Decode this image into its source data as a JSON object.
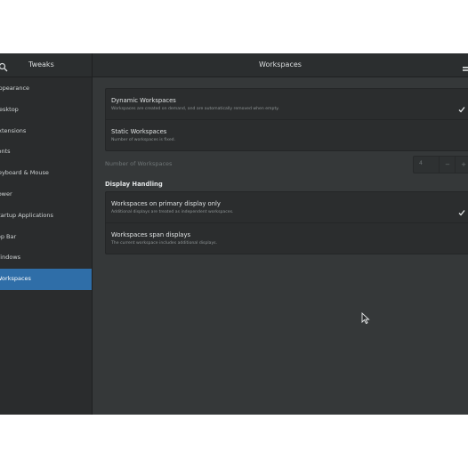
{
  "window": {
    "app_title": "Tweaks",
    "page_title": "Workspaces"
  },
  "sidebar": {
    "items": [
      {
        "label": "Appearance"
      },
      {
        "label": "Desktop"
      },
      {
        "label": "Extensions"
      },
      {
        "label": "Fonts"
      },
      {
        "label": "Keyboard & Mouse"
      },
      {
        "label": "Power"
      },
      {
        "label": "Startup Applications"
      },
      {
        "label": "Top Bar"
      },
      {
        "label": "Windows"
      },
      {
        "label": "Workspaces",
        "active": true
      }
    ]
  },
  "workspaces": {
    "dynamic": {
      "title": "Dynamic Workspaces",
      "subtitle": "Workspaces are created on demand, and are automatically removed when empty.",
      "checked": true
    },
    "static": {
      "title": "Static Workspaces",
      "subtitle": "Number of workspaces is fixed.",
      "checked": false
    },
    "number_label": "Number of Workspaces",
    "number_value": "4",
    "minus": "−",
    "plus": "+"
  },
  "display_handling": {
    "heading": "Display Handling",
    "primary": {
      "title": "Workspaces on primary display only",
      "subtitle": "Additional displays are treated as independent workspaces.",
      "checked": true
    },
    "span": {
      "title": "Workspaces span displays",
      "subtitle": "The current workspace includes additional displays.",
      "checked": false
    }
  },
  "colors": {
    "accent": "#2f6ea8",
    "window_bg": "#353839",
    "sidebar_bg": "#2a2c2d"
  }
}
